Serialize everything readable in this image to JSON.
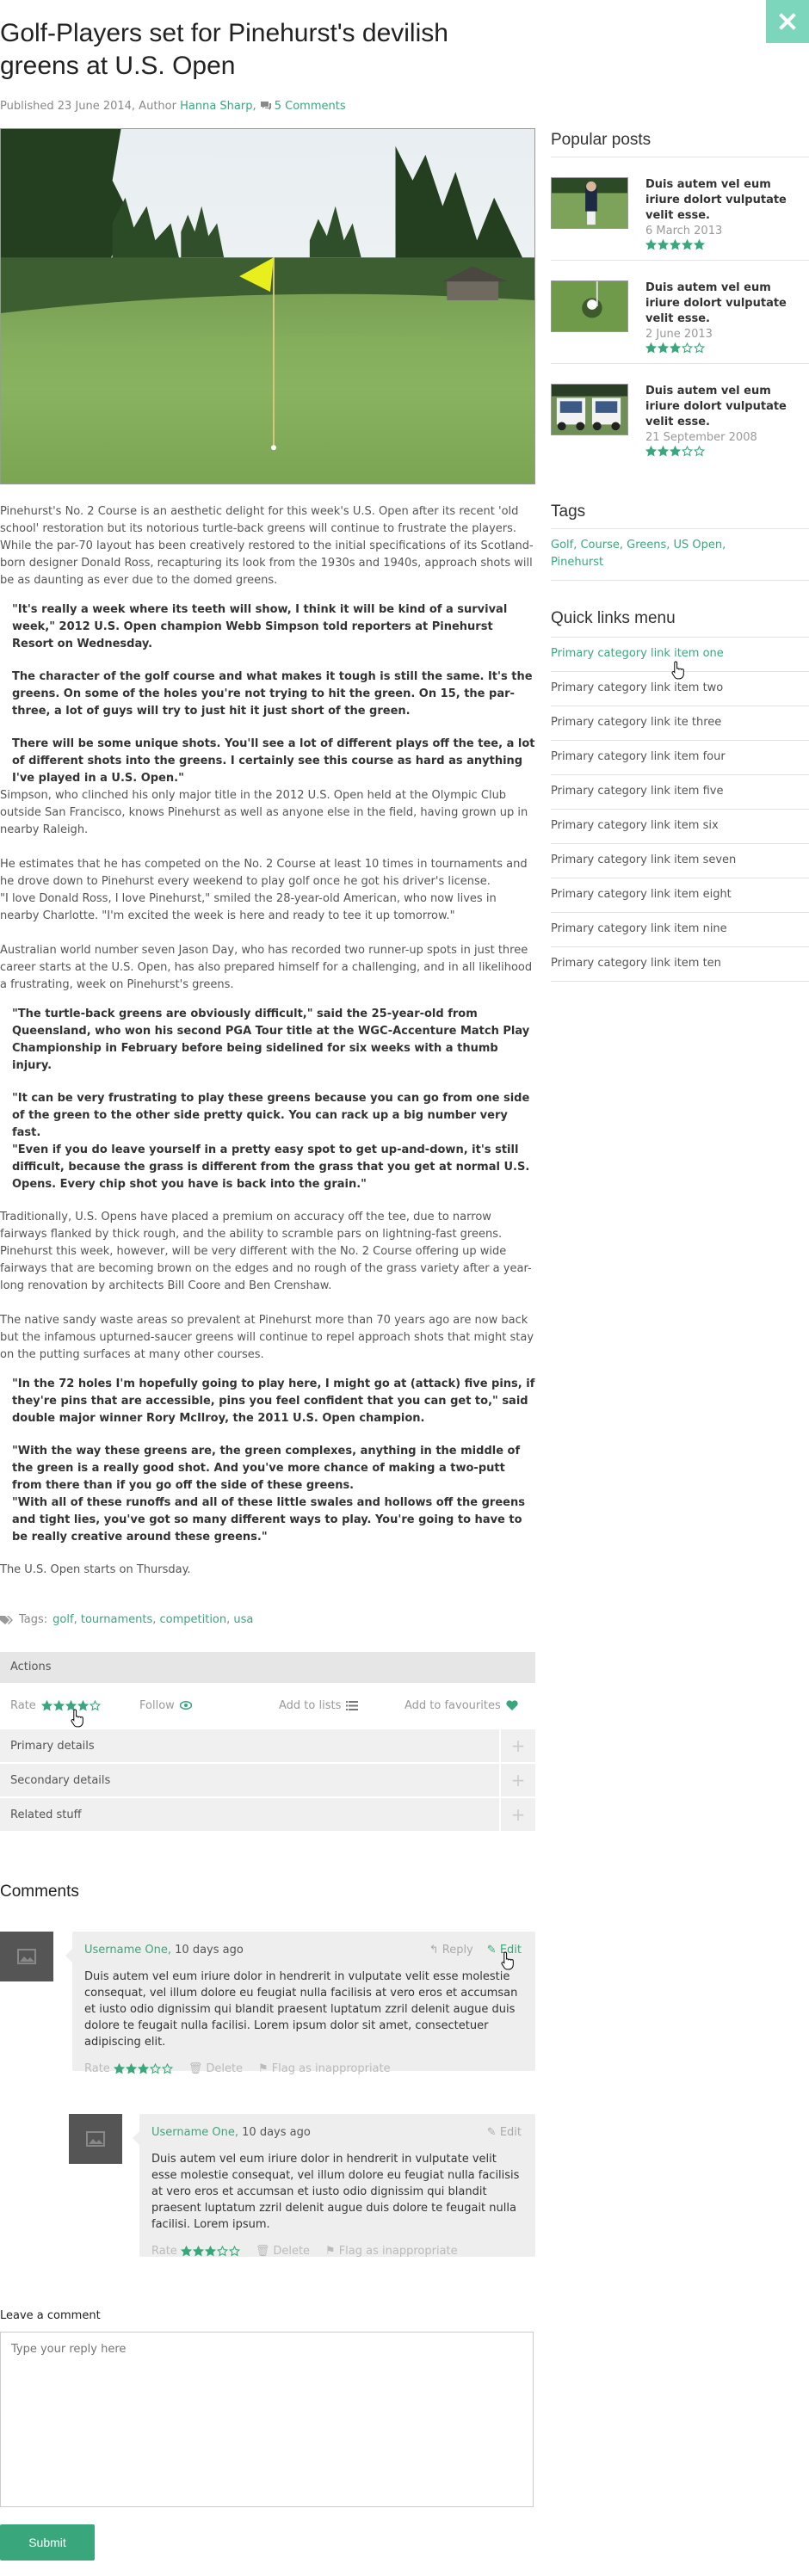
{
  "article": {
    "title": "Golf-Players set for Pinehurst's devilish greens at U.S. Open",
    "meta_published": "Published 23 June 2014, Author ",
    "meta_author": "Hanna Sharp,",
    "meta_comments": "5 Comments",
    "body": {
      "p1a": "Pinehurst's No. 2 Course is an aesthetic delight for this week's U.S. Open after its recent 'old school' restoration but its notorious turtle-back greens will continue to frustrate the players.",
      "p1b": "While the par-70 layout has been creatively restored to the initial specifications of its Scotland-born designer Donald Ross, recapturing its look from the 1930s and 1940s, approach shots will be as daunting as ever due to the domed greens.",
      "q1": "\"It's really a week where its teeth will show, I think it will be kind of a survival week,\" 2012 U.S. Open champion Webb Simpson told reporters at Pinehurst Resort on Wednesday.",
      "q2": "The character of the golf course and what makes it tough is still the same. It's the greens. On some of the holes you're not trying to hit the green. On 15, the par-three, a lot of guys will try to just hit it just short of the green.",
      "q3": "There will be some unique shots. You'll see a lot of different plays off the tee, a lot of different shots into the greens. I certainly see this course as hard as anything I've played in a U.S. Open.\"",
      "p2": "Simpson, who clinched his only major title in the 2012 U.S. Open held at the Olympic Club outside San Francisco, knows Pinehurst as well as anyone else in the field, having grown up in nearby Raleigh.",
      "p3a": "He estimates that he has competed on the No. 2 Course at least 10 times in tournaments and he drove down to Pinehurst every weekend to play golf once he got his driver's license.",
      "p3b": "\"I love Donald Ross, I love Pinehurst,\" smiled the 28-year-old American, who now lives in nearby Charlotte. \"I'm excited the week is here and ready to tee it up tomorrow.\"",
      "p4": " Australian world number seven Jason Day, who has recorded two runner-up spots in just three career starts at the U.S. Open, has also prepared himself for a challenging, and in all likelihood a frustrating, week on Pinehurst's greens.",
      "q4": "\"The turtle-back greens are obviously difficult,\" said the 25-year-old from Queensland, who won his second PGA Tour title at the WGC-Accenture Match Play Championship in February before being sidelined for six weeks with a thumb injury.",
      "q5a": "\"It can be very frustrating to play these greens because you can go from one side of the green to the other side pretty quick. You can rack up a big number very fast.",
      "q5b": "\"Even if you do leave yourself in a pretty easy spot to get up-and-down, it's still difficult, because the grass is different from the grass that you get at normal U.S. Opens. Every chip shot you have is back into the grain.\"",
      "p5a": "Traditionally, U.S. Opens have placed a premium on accuracy off the tee, due to narrow fairways flanked by thick rough, and the ability to scramble pars on lightning-fast greens.",
      "p5b": "Pinehurst this week, however, will be very different with the No. 2 Course offering up wide fairways that are becoming brown on the edges and no rough of the grass variety after a year-long renovation by architects Bill Coore and Ben Crenshaw.",
      "p6": "The native sandy waste areas so prevalent at Pinehurst more than 70 years ago are now back but the infamous upturned-saucer greens will continue to repel approach shots that might stay on the putting surfaces at many other courses.",
      "q6": "\"In the 72 holes I'm hopefully going to play here, I might go at (attack) five pins, if they're pins that are accessible, pins you feel confident that you can get to,\" said double major winner Rory McIlroy, the 2011 U.S. Open champion.",
      "q7a": "\"With the way these greens are, the green complexes, anything in the middle of the green is a really good shot. And you've more chance of making a two-putt from there than if you go off the side of these greens.",
      "q7b": "\"With all of these runoffs and all of these little swales and hollows off the greens and tight lies, you've got so many different ways to play. You're going to have to be really creative around these greens.\"",
      "p7": "The U.S. Open starts on Thursday."
    },
    "tags_label": "Tags: ",
    "tags": [
      "golf",
      "tournaments",
      "competition",
      "usa"
    ]
  },
  "actions": {
    "header": "Actions",
    "rate_label": "Rate",
    "rate_value": 4,
    "follow_label": "Follow",
    "add_lists_label": "Add to lists",
    "add_fav_label": "Add to favourites",
    "accordion": [
      "Primary details",
      "Secondary details",
      "Related stuff"
    ]
  },
  "comments": {
    "title": "Comments",
    "items": [
      {
        "user": "Username One,",
        "time": " 10 days ago",
        "reply": "Reply",
        "edit": "Edit",
        "text": "Duis autem vel eum iriure dolor in hendrerit in vulputate velit esse molestie consequat, vel illum dolore eu feugiat nulla facilisis at vero eros et accumsan et iusto odio dignissim qui blandit praesent luptatum zzril delenit augue duis dolore te feugait nulla facilisi. Lorem ipsum dolor sit amet, consectetuer adipiscing elit.",
        "rate": "Rate",
        "rating": 3,
        "delete": "Delete",
        "flag": "Flag as inappropriate"
      },
      {
        "user": "Username One,",
        "time": " 10 days ago",
        "edit": "Edit",
        "text": "Duis autem vel eum iriure dolor in hendrerit in vulputate velit esse molestie consequat, vel illum dolore eu feugiat nulla facilisis at vero eros et accumsan et iusto odio dignissim qui blandit praesent luptatum zzril delenit augue duis dolore te feugait nulla facilisi. Lorem ipsum.",
        "rate": "Rate",
        "rating": 3,
        "delete": "Delete",
        "flag": "Flag as inappropriate"
      }
    ],
    "leave_label": "Leave a comment",
    "placeholder": "Type your reply here",
    "submit": "Submit"
  },
  "sidebar": {
    "popular_title": "Popular posts",
    "popular": [
      {
        "title": "Duis autem vel eum iriure dolort vulputate velit esse.",
        "date": "6 March 2013",
        "rating": 5
      },
      {
        "title": "Duis autem vel eum iriure dolort vulputate velit esse.",
        "date": "2 June 2013",
        "rating": 3
      },
      {
        "title": "Duis autem vel eum iriure dolort vulputate velit esse.",
        "date": "21 September 2008",
        "rating": 3
      }
    ],
    "tags_title": "Tags",
    "tags_text": "Golf, Course, Greens, US Open, Pinehurst",
    "quick_title": "Quick links menu",
    "quick": [
      "Primary category link item one",
      "Primary category link item two",
      "Primary category link ite three",
      "Primary category link item four",
      "Primary category link item five",
      "Primary category link item six",
      "Primary category link item seven",
      "Primary category link item eight",
      "Primary category link item nine",
      "Primary category link item ten"
    ]
  },
  "colors": {
    "accent": "#39a77b",
    "close": "#7cd6bb"
  }
}
